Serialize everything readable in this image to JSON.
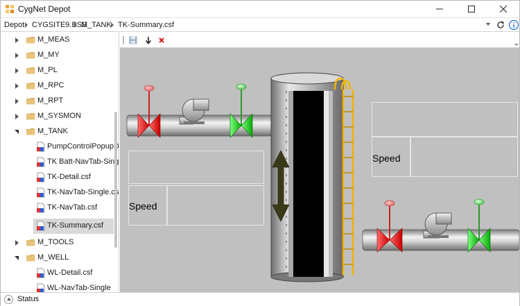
{
  "window": {
    "title": "CygNet Depot"
  },
  "breadcrumb": {
    "items": [
      "Depot",
      "CYGSITE9.BSS",
      "M_TANK",
      "TK-Summary.csf"
    ]
  },
  "tree": {
    "items": [
      {
        "label": "M_MEAS",
        "type": "folder",
        "state": "collapsed"
      },
      {
        "label": "M_MY",
        "type": "folder",
        "state": "collapsed"
      },
      {
        "label": "M_PL",
        "type": "folder",
        "state": "collapsed"
      },
      {
        "label": "M_RPC",
        "type": "folder",
        "state": "collapsed"
      },
      {
        "label": "M_RPT",
        "type": "folder",
        "state": "collapsed"
      },
      {
        "label": "M_SYSMON",
        "type": "folder",
        "state": "collapsed"
      },
      {
        "label": "M_TANK",
        "type": "folder",
        "state": "expanded"
      },
      {
        "label": "PumpControlPopupDl.csf",
        "type": "file"
      },
      {
        "label": "TK Batt-NavTab-Single.csf",
        "type": "file"
      },
      {
        "label": "TK-Detail.csf",
        "type": "file"
      },
      {
        "label": "TK-NavTab-Single.csf",
        "type": "file"
      },
      {
        "label": "TK-NavTab.csf",
        "type": "file"
      },
      {
        "label": "TK-Summary.csf",
        "type": "file",
        "selected": true
      },
      {
        "label": "M_TOOLS",
        "type": "folder",
        "state": "collapsed"
      },
      {
        "label": "M_WELL",
        "type": "folder",
        "state": "expanded"
      },
      {
        "label": "WL-Detail.csf",
        "type": "file"
      },
      {
        "label": "WL-NavTab-Single",
        "type": "file"
      }
    ]
  },
  "canvas": {
    "speed_label_left": "Speed",
    "speed_label_right": "Speed"
  },
  "status": {
    "label": "Status"
  },
  "colors": {
    "canvas_bg": "#c0c0c0",
    "valve_red": "#e81010",
    "valve_green": "#18d018",
    "ladder_yellow": "#f0b400",
    "tank_fill": "#000000",
    "arrow_dark": "#3a3a18"
  }
}
